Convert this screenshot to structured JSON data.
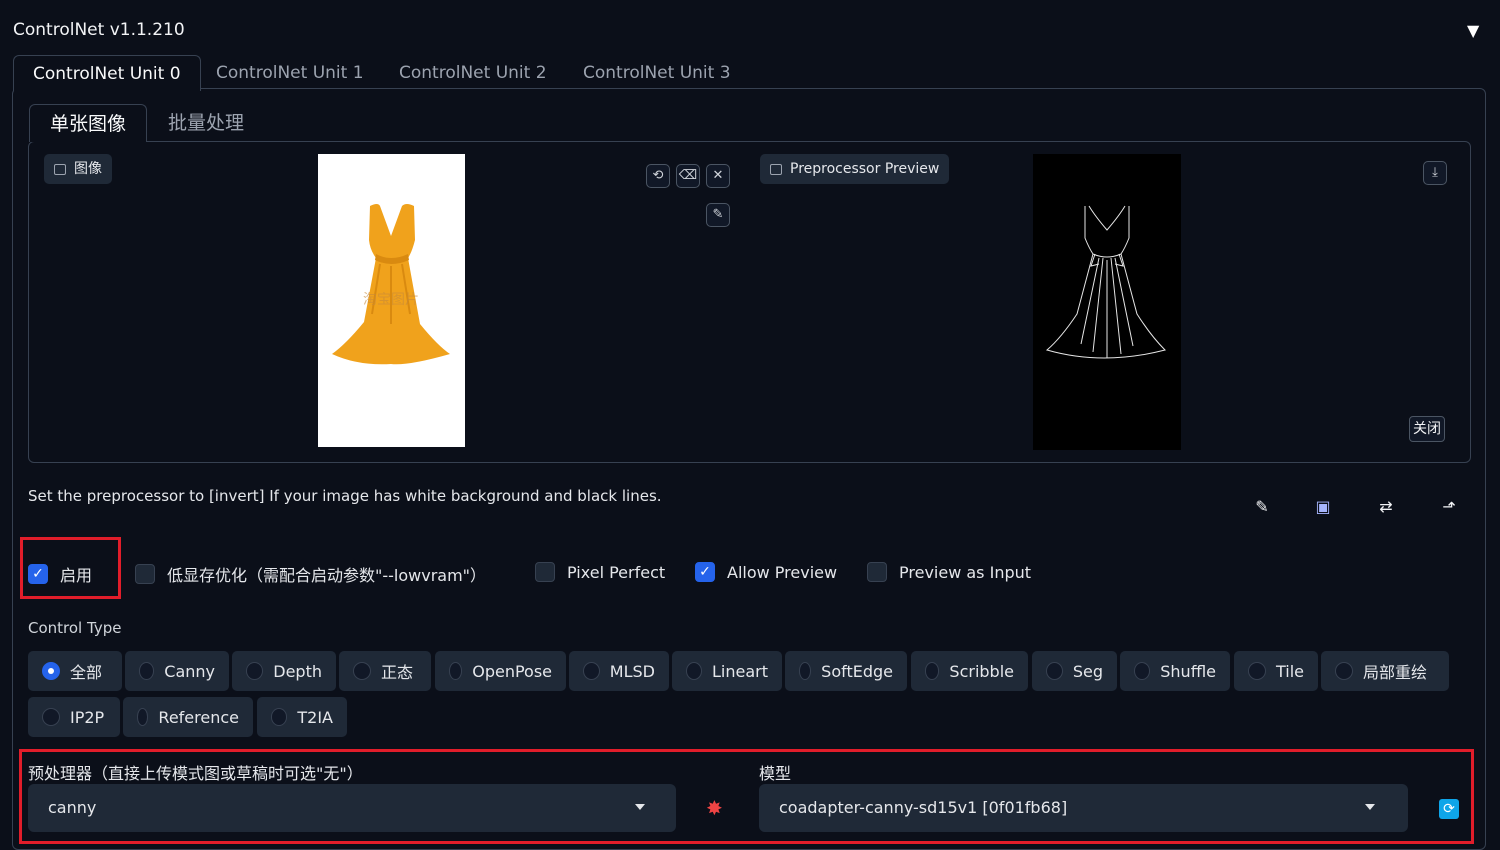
{
  "header": {
    "title": "ControlNet v1.1.210",
    "collapse_glyph": "▼"
  },
  "tabs": [
    "ControlNet Unit 0",
    "ControlNet Unit 1",
    "ControlNet Unit 2",
    "ControlNet Unit 3"
  ],
  "subtabs": [
    "单张图像",
    "批量处理"
  ],
  "image_panel": {
    "label": "图像",
    "watermark": "淘宝图片"
  },
  "preview_panel": {
    "label": "Preprocessor Preview",
    "close_label": "关闭"
  },
  "hint": "Set the preprocessor to [invert] If your image has white background and black lines.",
  "checkboxes": {
    "enable": {
      "label": "启用",
      "checked": true
    },
    "lowvram": {
      "label": "低显存优化（需配合启动参数\"--lowvram\"）",
      "checked": false
    },
    "pixel_perfect": {
      "label": "Pixel Perfect",
      "checked": false
    },
    "allow_preview": {
      "label": "Allow Preview",
      "checked": true
    },
    "preview_as_input": {
      "label": "Preview as Input",
      "checked": false
    }
  },
  "control_type": {
    "label": "Control Type",
    "options": [
      "全部",
      "Canny",
      "Depth",
      "正态",
      "OpenPose",
      "MLSD",
      "Lineart",
      "SoftEdge",
      "Scribble",
      "Seg",
      "Shuffle",
      "Tile",
      "局部重绘",
      "IP2P",
      "Reference",
      "T2IA"
    ],
    "selected": "全部"
  },
  "preprocessor": {
    "label": "预处理器（直接上传模式图或草稿时可选\"无\"）",
    "value": "canny"
  },
  "model": {
    "label": "模型",
    "value": "coadapter-canny-sd15v1 [0f01fb68]"
  },
  "colors": {
    "accent": "#2563eb",
    "highlight": "#e11d2a",
    "background": "#0b0f19"
  }
}
